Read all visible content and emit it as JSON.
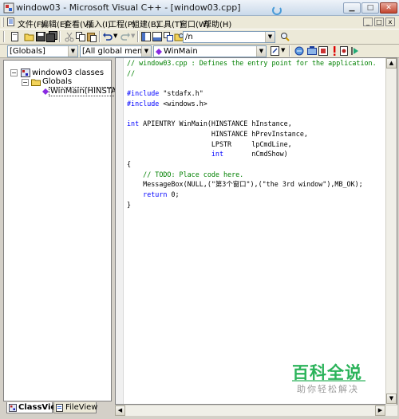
{
  "window": {
    "title": "window03 - Microsoft Visual C++ - [window03.cpp]",
    "controls": {
      "minimize": "0",
      "maximize": "1",
      "close": "r"
    }
  },
  "menubar": {
    "items": [
      "文件(F)",
      "编辑(E)",
      "查看(V)",
      "插入(I)",
      "工程(P)",
      "组建(B)",
      "工具(T)",
      "窗口(W)",
      "帮助(H)"
    ],
    "mdi_controls": [
      "_",
      "□",
      "x"
    ]
  },
  "toolbar": {
    "find_combo_value": "/n"
  },
  "wizardbar": {
    "class_combo": "[Globals]",
    "filter_combo": "[All global members",
    "member_combo": "WinMain"
  },
  "workspace": {
    "tree": {
      "root": "window03 classes",
      "child": "Globals",
      "leaf": "WinMain(HINSTANC"
    },
    "tabs": [
      "ClassView",
      "FileView"
    ]
  },
  "editor": {
    "lines": [
      [
        {
          "t": "// window03.cpp : Defines the entry point for the application.",
          "c": "comment"
        }
      ],
      [
        {
          "t": "//",
          "c": "comment"
        }
      ],
      [],
      [
        {
          "t": "#include",
          "c": "kw"
        },
        {
          "t": " \"stdafx.h\"",
          "c": "text"
        }
      ],
      [
        {
          "t": "#include",
          "c": "kw"
        },
        {
          "t": " <windows.h>",
          "c": "text"
        }
      ],
      [],
      [
        {
          "t": "int",
          "c": "kw"
        },
        {
          "t": " APIENTRY WinMain(HINSTANCE hInstance,",
          "c": "text"
        }
      ],
      [
        {
          "t": "                     HINSTANCE hPrevInstance,",
          "c": "text"
        }
      ],
      [
        {
          "t": "                     LPSTR     lpCmdLine,",
          "c": "text"
        }
      ],
      [
        {
          "t": "                     ",
          "c": "text"
        },
        {
          "t": "int",
          "c": "kw"
        },
        {
          "t": "       nCmdShow)",
          "c": "text"
        }
      ],
      [
        {
          "t": "{",
          "c": "text"
        }
      ],
      [
        {
          "t": "    // TODO: Place code here.",
          "c": "comment"
        }
      ],
      [
        {
          "t": "    MessageBox(NULL,(\"第3个窗口\"),(\"the 3rd window\"),MB_OK);",
          "c": "text"
        }
      ],
      [
        {
          "t": "    ",
          "c": "text"
        },
        {
          "t": "return",
          "c": "kw"
        },
        {
          "t": " 0;",
          "c": "text"
        }
      ],
      [
        {
          "t": "}",
          "c": "text"
        }
      ]
    ]
  },
  "watermark": {
    "main": "百科全说",
    "sub": "助你轻松解决"
  },
  "colors": {
    "comment": "#008000",
    "keyword": "#0000ff",
    "watermark_green": "#2bb35a"
  },
  "icons": {
    "toolbar1": [
      "new-file-icon",
      "open-folder-icon",
      "save-icon",
      "save-all-icon",
      "cut-icon",
      "copy-icon",
      "paste-icon",
      "undo-icon",
      "redo-icon",
      "workspace-icon",
      "output-icon",
      "window-list-icon",
      "find-in-files-icon",
      "search-icon"
    ],
    "toolbar2": [
      "wizard-action-icon",
      "compile-icon",
      "build-icon",
      "stop-build-icon",
      "execute-icon",
      "insert-breakpoint-icon",
      "go-icon"
    ]
  }
}
